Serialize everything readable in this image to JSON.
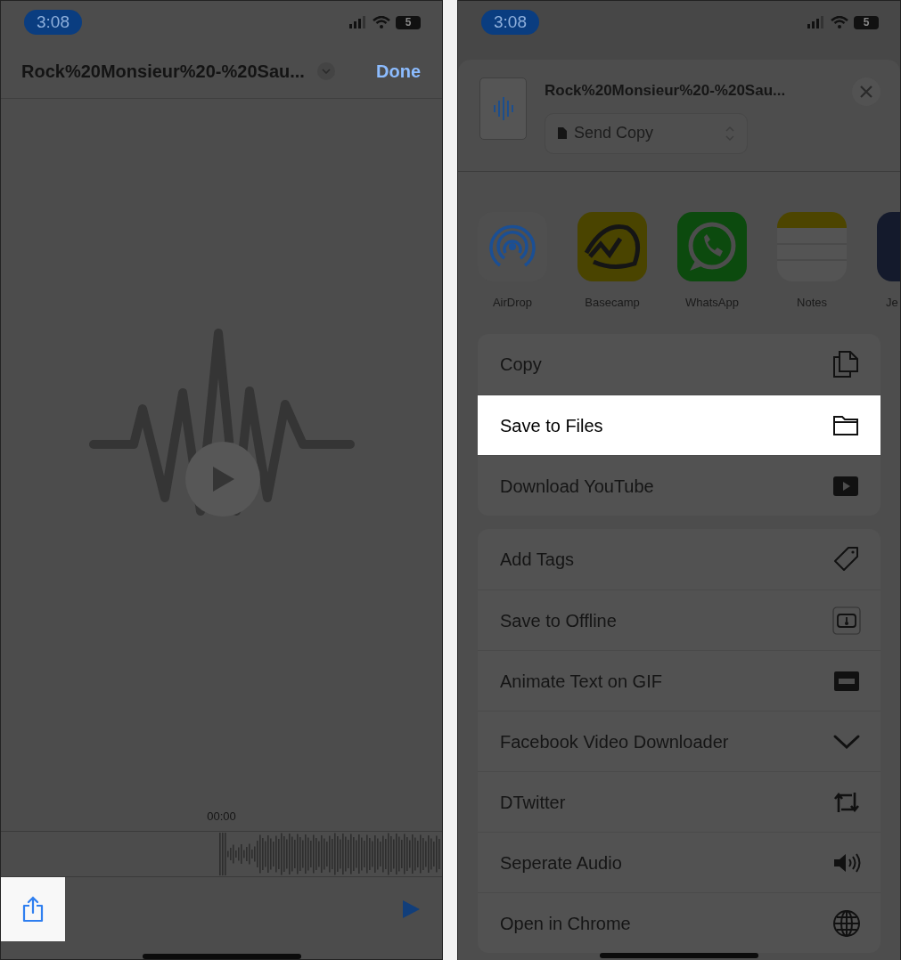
{
  "left_screen": {
    "status_bar": {
      "time": "3:08",
      "battery": "5"
    },
    "header": {
      "title": "Rock%20Monsieur%20-%20Sau...",
      "done": "Done"
    },
    "timestamp": "00:00",
    "toolbar": {
      "share_highlighted": true
    }
  },
  "right_screen": {
    "status_bar": {
      "time": "3:08",
      "battery": "5"
    },
    "share_sheet": {
      "file_title": "Rock%20Monsieur%20-%20Sau...",
      "mode": "Send Copy",
      "apps": [
        {
          "name": "AirDrop",
          "kind": "airdrop"
        },
        {
          "name": "Basecamp",
          "kind": "basecamp"
        },
        {
          "name": "WhatsApp",
          "kind": "whatsapp"
        },
        {
          "name": "Notes",
          "kind": "notes"
        },
        {
          "name": "Je",
          "kind": "partial"
        }
      ],
      "action_groups": [
        [
          {
            "label": "Copy",
            "kind": "copy",
            "highlighted": false
          },
          {
            "label": "Save to Files",
            "kind": "folder",
            "highlighted": true
          },
          {
            "label": "Download YouTube",
            "kind": "play",
            "highlighted": false
          }
        ],
        [
          {
            "label": "Add Tags",
            "kind": "tag",
            "highlighted": false
          },
          {
            "label": "Save to Offline",
            "kind": "offline",
            "highlighted": false
          },
          {
            "label": "Animate Text on GIF",
            "kind": "film",
            "highlighted": false
          },
          {
            "label": "Facebook Video Downloader",
            "kind": "chevron",
            "highlighted": false
          },
          {
            "label": "DTwitter",
            "kind": "retweet",
            "highlighted": false
          },
          {
            "label": "Seperate Audio",
            "kind": "speaker",
            "highlighted": false
          },
          {
            "label": "Open in Chrome",
            "kind": "globe",
            "highlighted": false
          }
        ]
      ]
    }
  }
}
